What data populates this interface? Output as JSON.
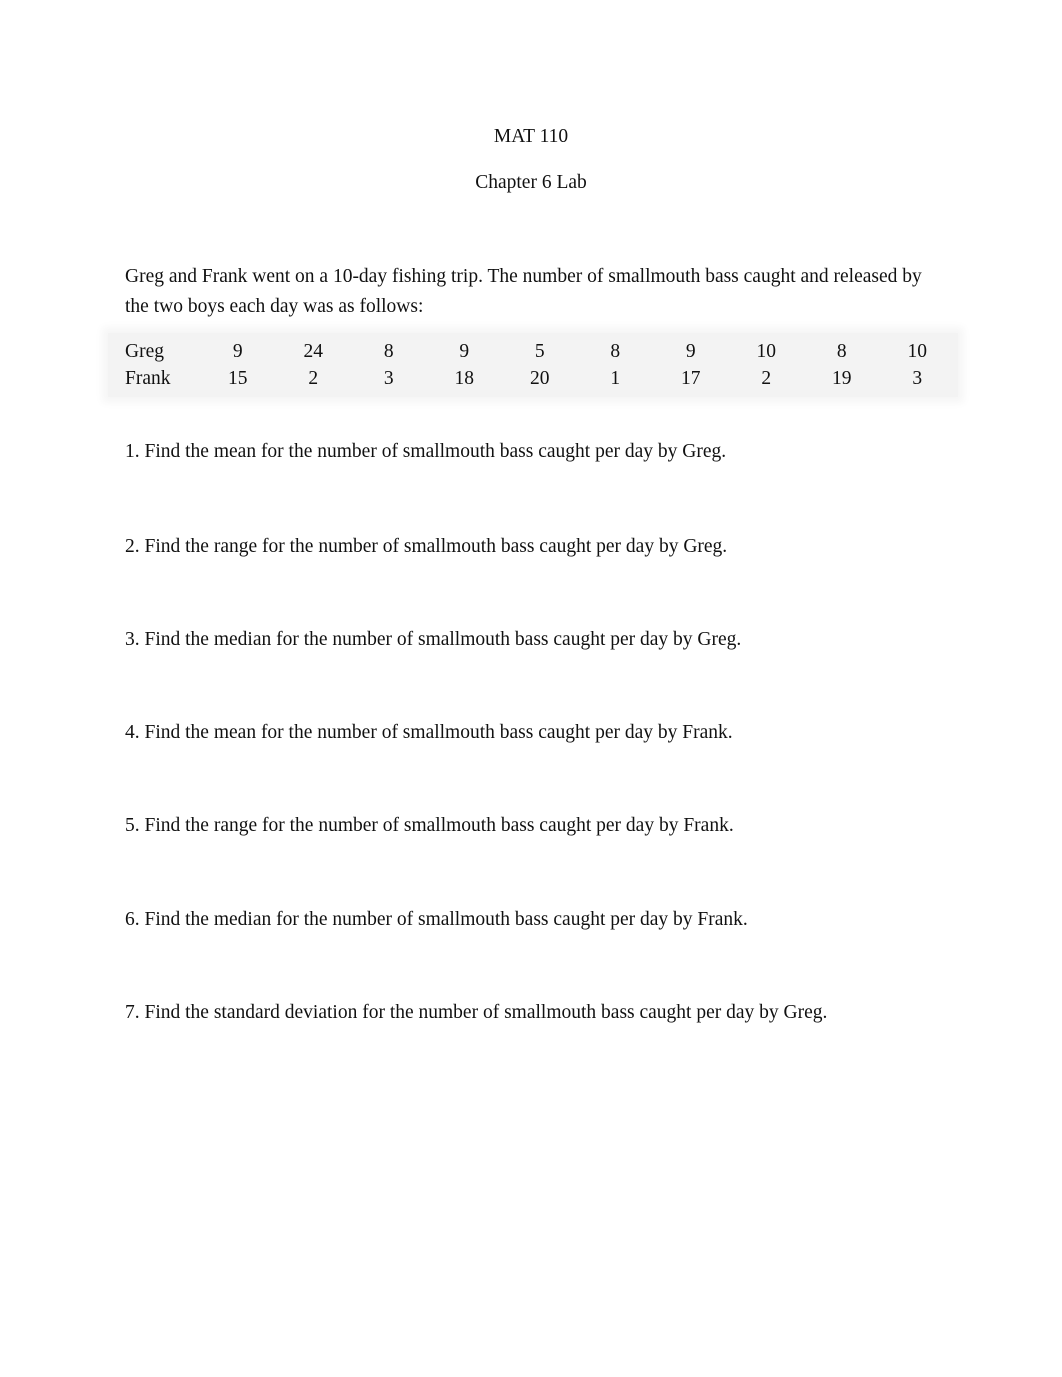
{
  "document": {
    "title": "MAT 110",
    "subtitle": "Chapter 6 Lab",
    "intro": "Greg and Frank went on a 10-day fishing trip.  The number of smallmouth bass caught and released by the two boys each day was as follows:",
    "table": {
      "rows": [
        {
          "name": "Greg",
          "values": [
            "9",
            "24",
            "8",
            "9",
            "5",
            "8",
            "9",
            "10",
            "8",
            "10"
          ]
        },
        {
          "name": "Frank",
          "values": [
            "15",
            "2",
            "3",
            "18",
            "20",
            "1",
            "17",
            "2",
            "19",
            "3"
          ]
        }
      ]
    },
    "questions": [
      "1. Find the mean for the number of smallmouth bass caught per day by Greg.",
      "2. Find the range for the number of smallmouth bass caught per day by Greg.",
      "3. Find the median for the number of smallmouth bass caught per day by Greg.",
      "4. Find the mean for the number of smallmouth bass caught per day by Frank.",
      "5. Find the range for the number of smallmouth bass caught per day by Frank.",
      "6. Find the median for the number of smallmouth bass caught per day by Frank.",
      "7. Find the standard deviation for the number of smallmouth bass caught per day by Greg."
    ]
  }
}
